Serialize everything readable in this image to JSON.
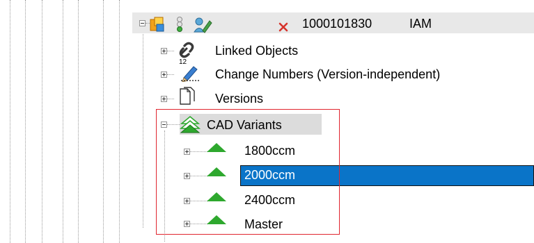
{
  "header": {
    "id_number": "1000101830",
    "type_code": "IAM"
  },
  "tree": {
    "linked_objects": "Linked Objects",
    "change_numbers": "Change Numbers (Version-independent)",
    "change_numbers_badge": "12",
    "versions": "Versions",
    "cad_variants": {
      "label": "CAD Variants",
      "children": [
        {
          "label": "1800ccm",
          "selected": false
        },
        {
          "label": "2000ccm",
          "selected": true
        },
        {
          "label": "2400ccm",
          "selected": false
        },
        {
          "label": "Master",
          "selected": false
        }
      ]
    }
  },
  "colors": {
    "selection": "#0a74c8",
    "highlight_box": "#e0242e",
    "variant_triangle": "#2ea82e"
  }
}
